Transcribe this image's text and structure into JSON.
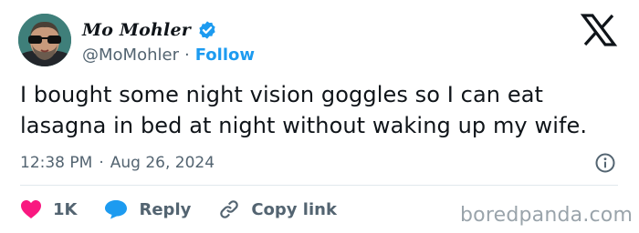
{
  "author": {
    "display_name": "Mo Mohler",
    "handle": "@MoMohler",
    "separator": "·",
    "follow_label": "Follow"
  },
  "tweet": {
    "text": "I bought some night vision goggles so I can eat lasagna in bed at night without waking up my wife.",
    "time": "12:38 PM",
    "separator": "·",
    "date": "Aug 26, 2024"
  },
  "actions": {
    "likes_count": "1K",
    "reply_label": "Reply",
    "copy_link_label": "Copy link"
  },
  "watermark": "boredpanda.com",
  "colors": {
    "accent": "#1d9bf0",
    "like": "#f91880",
    "text": "#0f1419",
    "secondary": "#536471",
    "divider": "#e1e8ed"
  },
  "icons": {
    "verified": "verified-badge-icon",
    "brand": "x-logo-icon",
    "info": "info-icon",
    "like": "heart-icon",
    "reply": "speech-bubble-icon",
    "copy_link": "link-icon"
  }
}
